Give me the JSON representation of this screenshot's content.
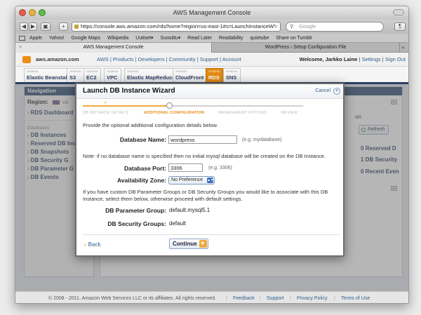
{
  "browser": {
    "window_title": "AWS Management Console",
    "url": "https://console.aws.amazon.com/rds/home?region=us-east-1#s=LaunchInstanceW",
    "search_placeholder": "Google",
    "bookmarks": [
      "Apple",
      "Yahoo!",
      "Google Maps",
      "Wikipedia",
      "Uutiset▾",
      "Suosittu▾",
      "Read Later",
      "Readability",
      "quietube",
      "Share on Tumblr"
    ],
    "tabs": [
      {
        "label": "AWS Management Console",
        "active": true
      },
      {
        "label": "WordPress › Setup Configuration File",
        "active": false
      }
    ]
  },
  "aws": {
    "domain": "aws.amazon.com",
    "links": "AWS | Products | Developers | Community | Support | Account",
    "welcome": "Welcome, Jarkko Laine",
    "settings": "Settings",
    "signout": "Sign Out",
    "services": [
      {
        "small": "Amazon",
        "name": "Elastic Beanstalk"
      },
      {
        "small": "Amazon",
        "name": "S3"
      },
      {
        "small": "Amazon",
        "name": "EC2"
      },
      {
        "small": "Amazon",
        "name": "VPC"
      },
      {
        "small": "Amazon",
        "name": "Elastic MapReduce"
      },
      {
        "small": "Amazon",
        "name": "CloudFront"
      },
      {
        "small": "Amazon",
        "name": "RDS"
      },
      {
        "small": "Amazon",
        "name": "SNS"
      }
    ]
  },
  "nav": {
    "title": "Navigation",
    "region_label": "Region:",
    "region_value": "US",
    "dashboard": "RDS Dashboard",
    "db_label": "Databases",
    "items": [
      "DB Instances",
      "Reserved DB Ins",
      "DB Snapshots",
      "DB Security G",
      "DB Parameter G",
      "DB Events"
    ]
  },
  "right": {
    "on_fragment": "on",
    "refresh": "Refresh",
    "reserved": "0 Reserved D",
    "security": "1 DB Security",
    "recent": "0 Recent Even"
  },
  "wizard": {
    "title": "Launch DB Instance Wizard",
    "cancel": "Cancel",
    "close_glyph": "×",
    "steps": [
      "DB INSTANCE DETAILS",
      "ADDITIONAL CONFIGURATION",
      "MANAGEMENT OPTIONS",
      "REVIEW"
    ],
    "current_step": 1,
    "intro": "Provide the optional additional configuration details below.",
    "db_name_label": "Database Name:",
    "db_name_value": "wordpress",
    "db_name_hint": "(e.g. mydatabase)",
    "note": "Note: if no database name is specified then no initial mysql database will be created on the DB Instance.",
    "port_label": "Database Port:",
    "port_value": "3306",
    "port_hint": "(e.g. 3306)",
    "az_label": "Availability Zone:",
    "az_value": "No Preference",
    "groups_text": "If you have custom DB Parameter Groups or DB Security Groups you would like to associate with this DB Instance, select them below, otherwise proceed with default settings.",
    "param_label": "DB Parameter Group:",
    "param_value": "default.mysql5.1",
    "security_label": "DB Security Groups:",
    "security_value": "default",
    "back": "Back",
    "continue": "Continue"
  },
  "footer": {
    "copyright": "© 2008 - 2011, Amazon Web Services LLC or its affiliates. All rights reserved.",
    "links": [
      "Feedback",
      "Support",
      "Privacy Policy",
      "Terms of Use"
    ]
  },
  "colors": {
    "accent": "#e28a14",
    "nav_header": "#2c4a73",
    "link": "#2d5f8e"
  }
}
